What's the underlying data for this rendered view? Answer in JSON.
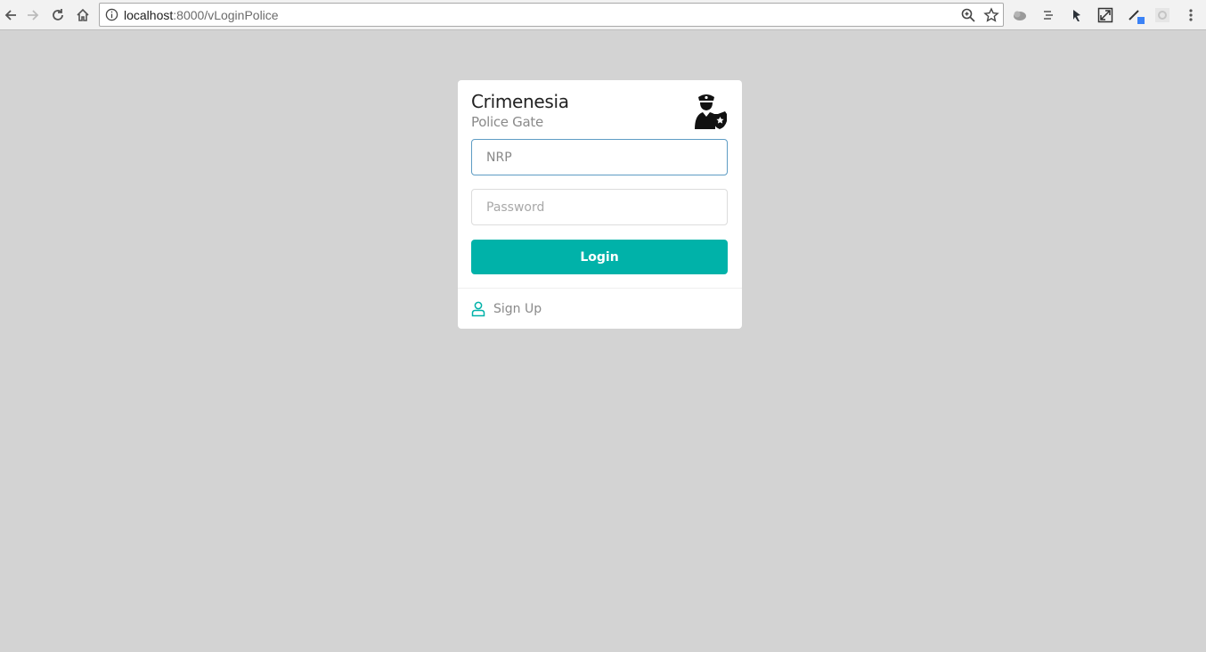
{
  "browser": {
    "url_host": "localhost",
    "url_path": ":8000/vLoginPolice"
  },
  "brand": {
    "title": "Crimenesia",
    "subtitle": "Police Gate"
  },
  "form": {
    "nrp_placeholder": "NRP",
    "password_placeholder": "Password",
    "login_label": "Login"
  },
  "footer": {
    "signup_label": "Sign Up"
  },
  "colors": {
    "accent": "#00b2a9",
    "background": "#d3d3d3"
  },
  "icons": {
    "police": "police-officer-icon",
    "user": "user-icon"
  }
}
